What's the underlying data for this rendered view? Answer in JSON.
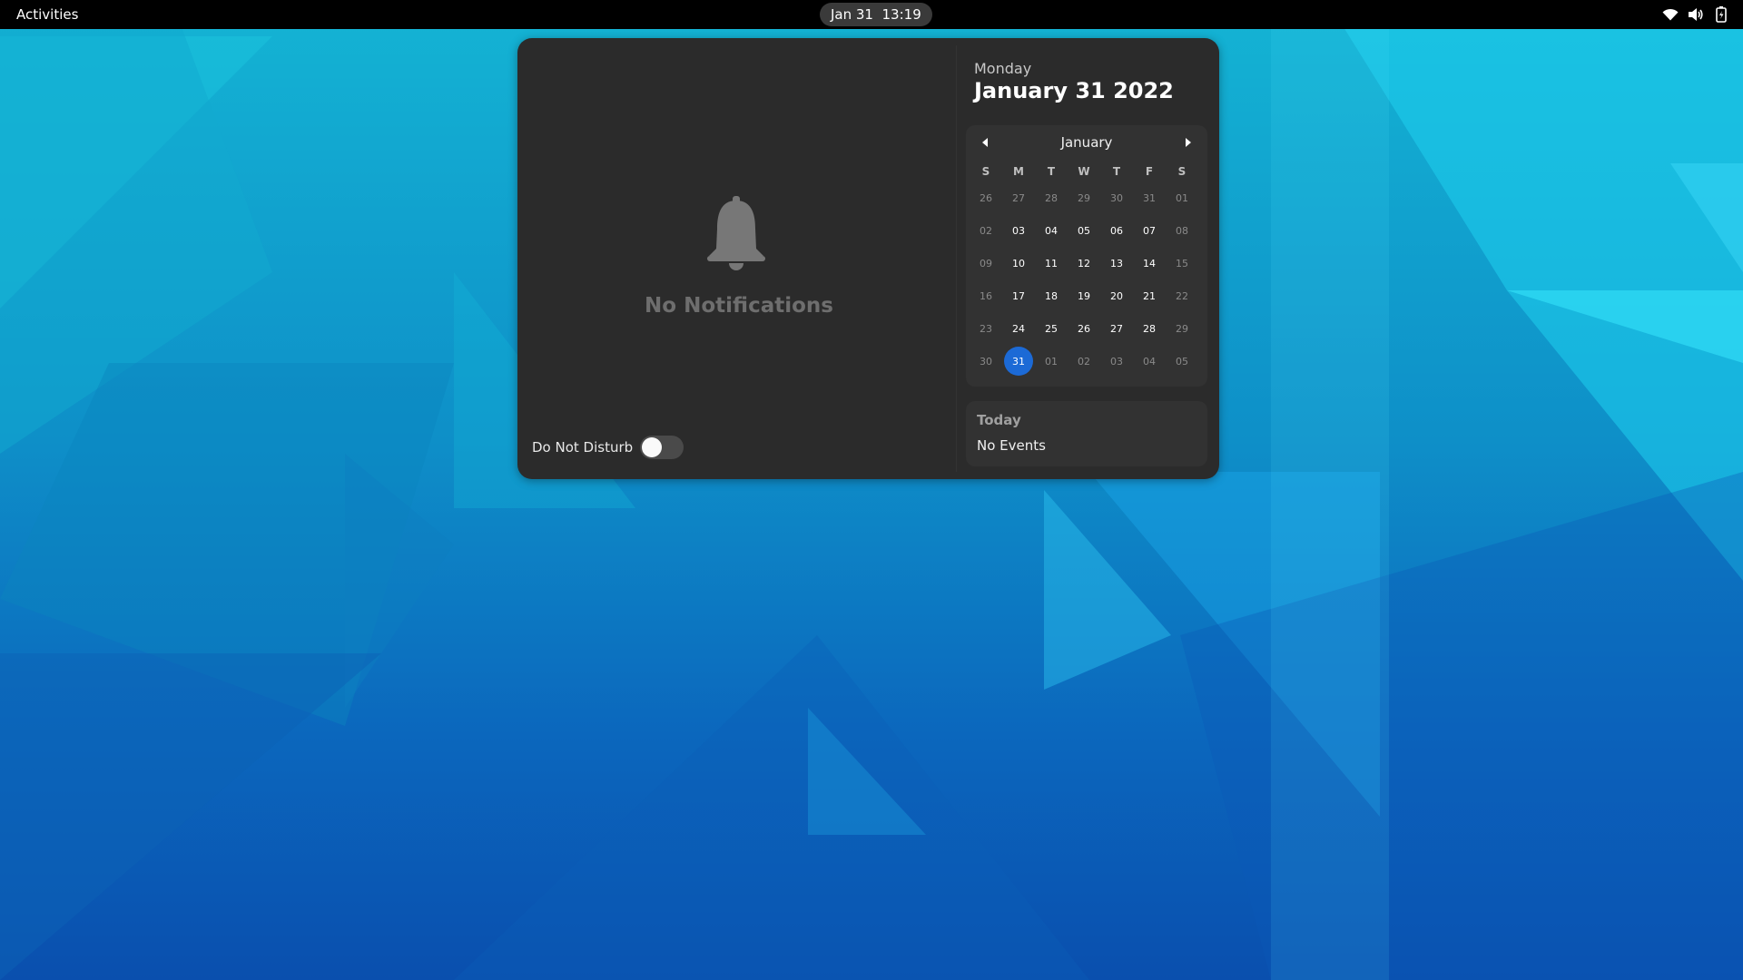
{
  "topbar": {
    "activities_label": "Activities",
    "clock_text": "Jan 31  13:19",
    "tray_icons": [
      "wifi-icon",
      "volume-icon",
      "battery-icon"
    ]
  },
  "notifications": {
    "empty_label": "No Notifications",
    "icon": "bell-icon",
    "dnd_label": "Do Not Disturb",
    "dnd_enabled": false
  },
  "calendar": {
    "weekday": "Monday",
    "full_date": "January 31 2022",
    "month_label": "January",
    "day_headers": [
      "S",
      "M",
      "T",
      "W",
      "T",
      "F",
      "S"
    ],
    "weeks": [
      [
        "26",
        "27",
        "28",
        "29",
        "30",
        "31",
        "01"
      ],
      [
        "02",
        "03",
        "04",
        "05",
        "06",
        "07",
        "08"
      ],
      [
        "09",
        "10",
        "11",
        "12",
        "13",
        "14",
        "15"
      ],
      [
        "16",
        "17",
        "18",
        "19",
        "20",
        "21",
        "22"
      ],
      [
        "23",
        "24",
        "25",
        "26",
        "27",
        "28",
        "29"
      ],
      [
        "30",
        "31",
        "01",
        "02",
        "03",
        "04",
        "05"
      ]
    ],
    "selected_day": "31",
    "accent_color": "#1c6ad6"
  },
  "events": {
    "title": "Today",
    "empty_label": "No Events"
  }
}
